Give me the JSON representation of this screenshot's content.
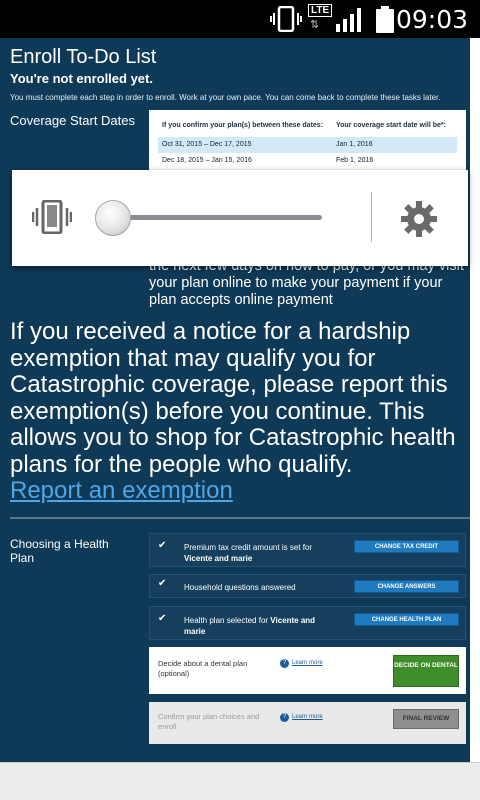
{
  "status_bar": {
    "time": "09:03",
    "network": "LTE",
    "icons": [
      "vibrate-icon",
      "lte-icon",
      "signal-icon",
      "battery-icon"
    ]
  },
  "enroll": {
    "title": "Enroll To-Do List",
    "subtitle": "You're not enrolled yet.",
    "description": "You must complete each step in order to enroll. Work at your own pace. You can come back to complete these tasks later."
  },
  "coverage": {
    "heading": "Coverage Start Dates",
    "col1_header": "If you confirm your plan(s) between these dates:",
    "col2_header": "Your coverage start date will be*:",
    "rows": [
      {
        "range": "Oct 31, 2015 – Dec 17, 2015",
        "start": "Jan 1, 2016"
      },
      {
        "range": "Dec 18, 2015 – Jan 15, 2016",
        "start": "Feb 1, 2016"
      }
    ]
  },
  "payment_text": "the next few days on how to pay, or you may visit your plan online to make your payment if your plan accepts online payment",
  "notice": {
    "text": "If you received a notice for a hardship exemption that may qualify you for Catastrophic coverage, please report this exemption(s) before you continue. This allows you to shop for Catastrophic health plans for the people who qualify.",
    "link": "Report an exemption"
  },
  "choosing": {
    "heading": "Choosing a Health Plan",
    "tasks": [
      {
        "text": "Premium tax credit amount is set for",
        "bold": "Vicente and marie",
        "button": "CHANGE TAX CREDIT"
      },
      {
        "text": "Household questions answered",
        "bold": "",
        "button": "CHANGE ANSWERS"
      },
      {
        "text": "Health plan selected for",
        "bold": "Vicente and marie",
        "button": "CHANGE HEALTH PLAN"
      }
    ],
    "dental": {
      "text": "Decide about a dental plan (optional)",
      "learn_more": "Learn more",
      "button": "DECIDE ON DENTAL"
    },
    "final": {
      "text": "Confirm your plan choices and enroll",
      "learn_more": "Learn more",
      "button": "FINAL REVIEW"
    }
  },
  "volume_panel": {
    "level": 0,
    "icons": [
      "vibrate-icon",
      "volume-slider",
      "settings-gear-icon"
    ]
  },
  "colors": {
    "page_bg": "#0f3a57",
    "link": "#4da6e8",
    "task_button": "#1f7ac0",
    "dental_button": "#3f8c2b"
  }
}
